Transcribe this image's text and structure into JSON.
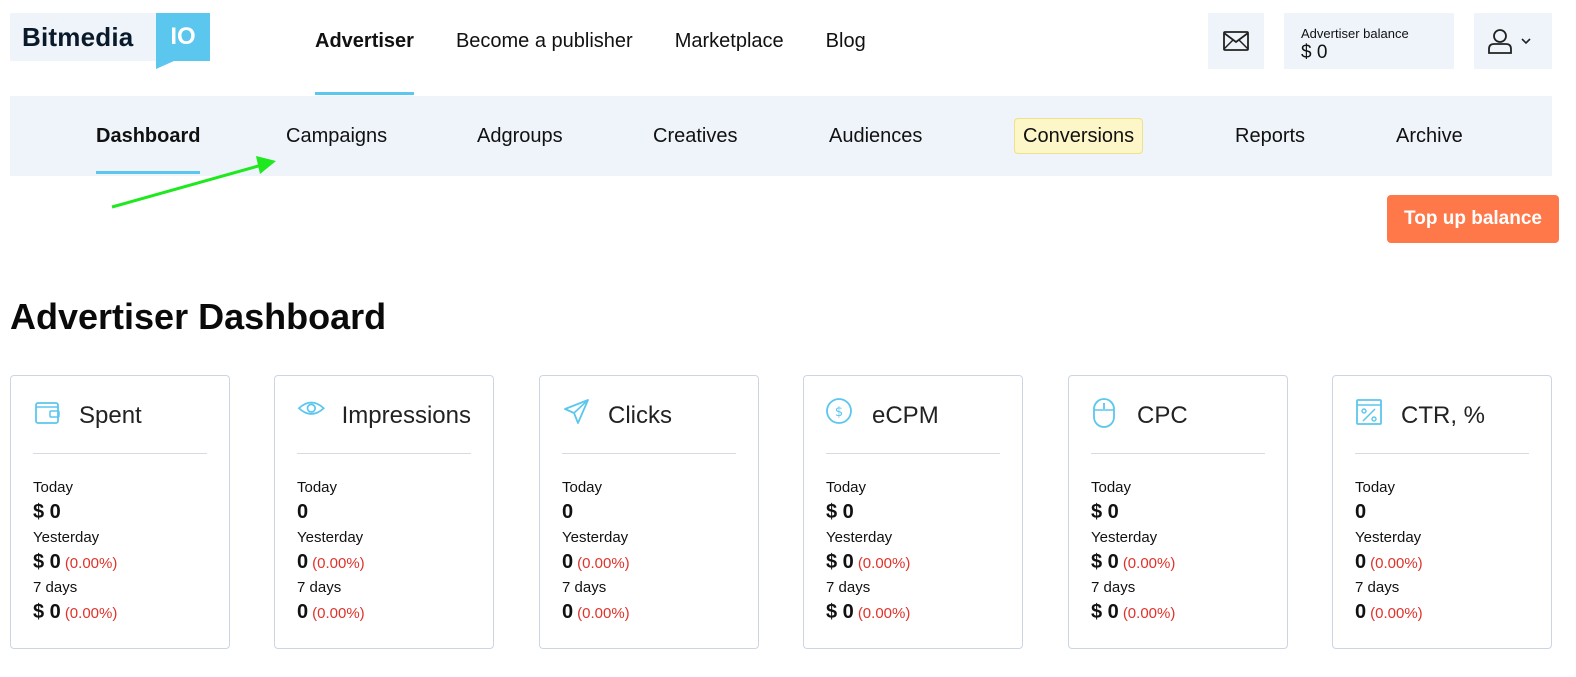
{
  "logo": {
    "text": "Bitmedia",
    "badge": "IO"
  },
  "topnav": [
    {
      "label": "Advertiser",
      "active": true
    },
    {
      "label": "Become a publisher",
      "active": false
    },
    {
      "label": "Marketplace",
      "active": false
    },
    {
      "label": "Blog",
      "active": false
    }
  ],
  "header": {
    "mail_icon": "envelope-icon",
    "balance_label": "Advertiser balance",
    "balance_value": "$ 0",
    "user_icon": "user-icon"
  },
  "subnav": [
    {
      "label": "Dashboard",
      "active": true
    },
    {
      "label": "Campaigns"
    },
    {
      "label": "Adgroups"
    },
    {
      "label": "Creatives"
    },
    {
      "label": "Audiences"
    },
    {
      "label": "Conversions",
      "highlight": true
    },
    {
      "label": "Reports"
    },
    {
      "label": "Archive"
    }
  ],
  "annotation_arrow_color": "#1ee81e",
  "topup_label": "Top up balance",
  "page_title": "Advertiser Dashboard",
  "period_labels": {
    "today": "Today",
    "yesterday": "Yesterday",
    "week": "7 days"
  },
  "cards": [
    {
      "icon": "wallet-icon",
      "title": "Spent",
      "today": "$ 0",
      "yesterday": "$ 0",
      "yesterday_pct": "(0.00%)",
      "week": "$ 0",
      "week_pct": "(0.00%)"
    },
    {
      "icon": "eye-icon",
      "title": "Impressions",
      "today": "0",
      "yesterday": "0",
      "yesterday_pct": "(0.00%)",
      "week": "0",
      "week_pct": "(0.00%)"
    },
    {
      "icon": "paper-plane-icon",
      "title": "Clicks",
      "today": "0",
      "yesterday": "0",
      "yesterday_pct": "(0.00%)",
      "week": "0",
      "week_pct": "(0.00%)"
    },
    {
      "icon": "dollar-coin-icon",
      "title": "eCPM",
      "today": "$ 0",
      "yesterday": "$ 0",
      "yesterday_pct": "(0.00%)",
      "week": "$ 0",
      "week_pct": "(0.00%)"
    },
    {
      "icon": "mouse-icon",
      "title": "CPC",
      "today": "$ 0",
      "yesterday": "$ 0",
      "yesterday_pct": "(0.00%)",
      "week": "$ 0",
      "week_pct": "(0.00%)"
    },
    {
      "icon": "percent-window-icon",
      "title": "CTR, %",
      "today": "0",
      "yesterday": "0",
      "yesterday_pct": "(0.00%)",
      "week": "0",
      "week_pct": "(0.00%)"
    }
  ],
  "colors": {
    "accent": "#5bc6ee",
    "topup": "#ff7849",
    "negative": "#e0322a",
    "panel": "#eef4f9"
  }
}
